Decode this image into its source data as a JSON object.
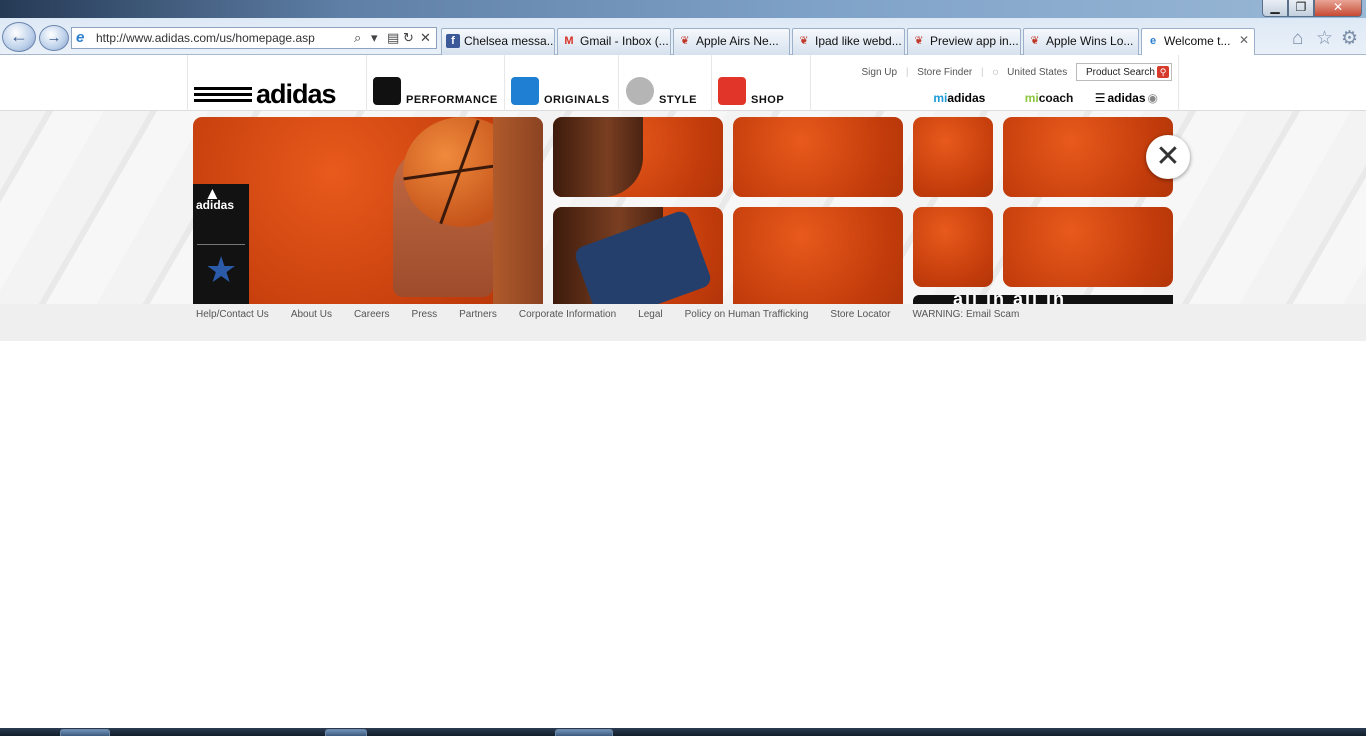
{
  "browser": {
    "window_controls": {
      "minimize": "▁",
      "maximize": "❐",
      "close": "✕"
    },
    "nav": {
      "back": "←",
      "forward": "→"
    },
    "address": {
      "url": "http://www.adidas.com/us/homepage.asp",
      "search_icon": "⌕",
      "dropdown_icon": "▾",
      "compat_icon": "▤",
      "refresh_icon": "↻",
      "stop_icon": "✕"
    },
    "tabs": [
      {
        "label": "Chelsea messa...",
        "icon": "facebook-icon",
        "icon_glyph": "f",
        "icon_color": "#3b5998",
        "active": false
      },
      {
        "label": "Gmail - Inbox (...",
        "icon": "gmail-icon",
        "icon_glyph": "M",
        "icon_color": "#d93025",
        "active": false
      },
      {
        "label": "Apple Airs Ne...",
        "icon": "apple-icon",
        "icon_glyph": "❦",
        "icon_color": "#c0392b",
        "active": false
      },
      {
        "label": "Ipad like webd...",
        "icon": "apple-icon",
        "icon_glyph": "❦",
        "icon_color": "#c0392b",
        "active": false
      },
      {
        "label": "Preview app in...",
        "icon": "apple-icon",
        "icon_glyph": "❦",
        "icon_color": "#c0392b",
        "active": false
      },
      {
        "label": "Apple Wins Lo...",
        "icon": "apple-icon",
        "icon_glyph": "❦",
        "icon_color": "#c0392b",
        "active": false
      },
      {
        "label": "Welcome t...",
        "icon": "ie-icon",
        "icon_glyph": "e",
        "icon_color": "#2c7fd0",
        "active": true,
        "close": "✕"
      }
    ],
    "toolbar_icons": {
      "home": "⌂",
      "favorites": "☆",
      "tools": "⚙"
    }
  },
  "site": {
    "logo": "adidas",
    "categories": [
      {
        "label": "PERFORMANCE",
        "icon": "performance-icon",
        "color": "#111111"
      },
      {
        "label": "ORIGINALS",
        "icon": "trefoil-icon",
        "color": "#1f7fd2"
      },
      {
        "label": "STYLE",
        "icon": "style-icon",
        "color": "#b5b5b5"
      },
      {
        "label": "SHOP",
        "icon": "shop-tag-icon",
        "color": "#e2352a"
      }
    ],
    "utility": {
      "sign_up": "Sign Up",
      "store_finder": "Store Finder",
      "country": "United States",
      "search_label": "Product Search"
    },
    "brand_links": {
      "miadidas_prefix": "mi",
      "miadidas_suffix": "adidas",
      "micoach_prefix": "mi",
      "micoach_suffix": "coach",
      "adidas_tv": "adidas"
    },
    "hero": {
      "badge_brand": "adidas",
      "close_glyph": "✕",
      "strip_text": "all in all in"
    },
    "footer_links": [
      "Help/Contact Us",
      "About Us",
      "Careers",
      "Press",
      "Partners",
      "Corporate Information",
      "Legal",
      "Policy on Human Trafficking",
      "Store Locator",
      "WARNING: Email Scam"
    ],
    "colors": {
      "accent_orange": "#d2470f",
      "brand_black": "#000000"
    }
  }
}
